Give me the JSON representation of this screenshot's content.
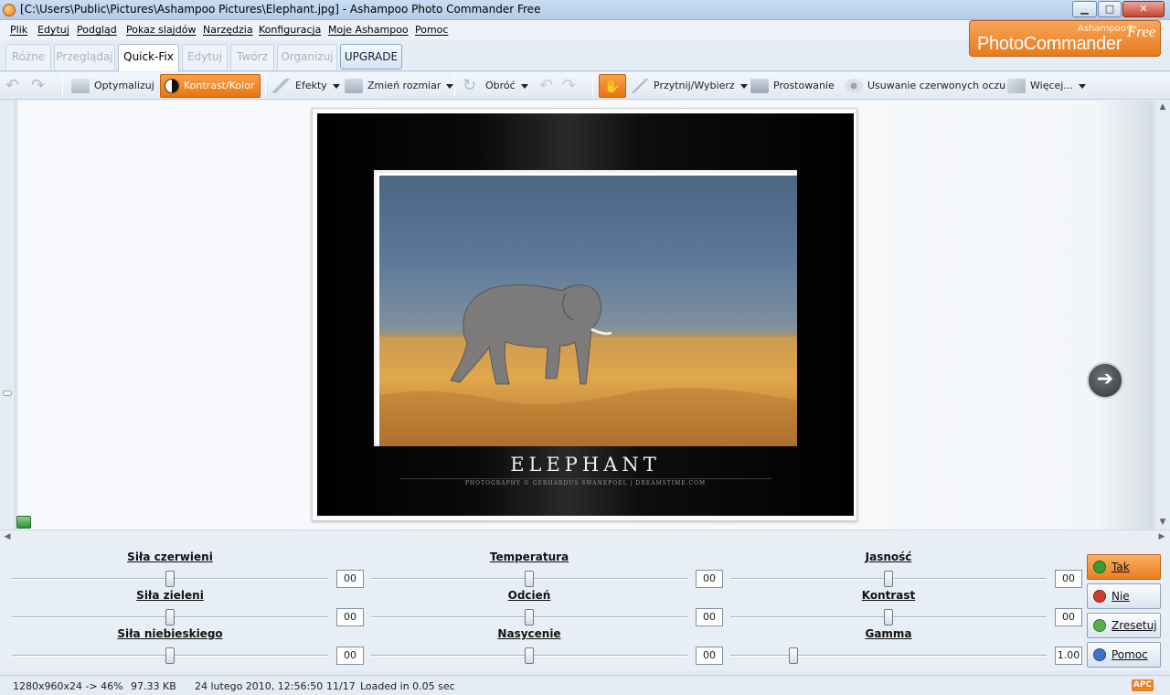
{
  "window": {
    "title": "[C:\\Users\\Public\\Pictures\\Ashampoo Pictures\\Elephant.jpg] - Ashampoo Photo Commander Free",
    "min_glyph": "▁",
    "max_glyph": "□",
    "close_glyph": "✕"
  },
  "menu": [
    "Plik",
    "Edytuj",
    "Podgląd",
    "Pokaz slajdów",
    "Narzędzia",
    "Konfiguracja",
    "Moje Ashampoo",
    "Pomoc"
  ],
  "brand": {
    "small": "Ashampoo®",
    "main": "PhotoCommander",
    "free": "Free"
  },
  "tabs": [
    "Różne",
    "Przeglądaj",
    "Quick-Fix",
    "Edytuj",
    "Twórz",
    "Organizuj",
    "UPGRADE"
  ],
  "toolbar": {
    "optymalizuj": "Optymalizuj",
    "kontrast": "Kontrast/Kolor",
    "efekty": "Efekty",
    "zmien": "Zmień rozmiar",
    "obroc": "Obróć",
    "przytnij": "Przytnij/Wybierz",
    "prostowanie": "Prostowanie",
    "usuwanie": "Usuwanie czerwonych oczu",
    "wiecej": "Więcej..."
  },
  "photo": {
    "title": "ELEPHANT",
    "credit": "PHOTOGRAPHY © GERHARDUS SWANEPOEL | DREAMSTIME.COM"
  },
  "sliders": [
    {
      "label": "Siła czerwieni",
      "value": "00",
      "level": 0.5
    },
    {
      "label": "Temperatura",
      "value": "00",
      "level": 0.5
    },
    {
      "label": "Jasność",
      "value": "00",
      "level": 0.5
    },
    {
      "label": "Siła zieleni",
      "value": "00",
      "level": 0.5
    },
    {
      "label": "Odcień",
      "value": "00",
      "level": 0.5
    },
    {
      "label": "Kontrast",
      "value": "00",
      "level": 0.5
    },
    {
      "label": "Siła niebieskiego",
      "value": "00",
      "level": 0.5
    },
    {
      "label": "Nasycenie",
      "value": "00",
      "level": 0.5
    },
    {
      "label": "Gamma",
      "value": "1.00",
      "level": 0.2
    }
  ],
  "actions": [
    "Tak",
    "Nie",
    "Zresetuj",
    "Pomoc"
  ],
  "status": {
    "dims": "1280x960x24 -> 46%",
    "size": "97.33 KB",
    "date": "24 lutego 2010, 12:56:50",
    "index": "11/17",
    "loaded": "Loaded in 0.05 sec",
    "badge": "APC"
  },
  "colors": {
    "accent": "#ea7d1f",
    "chrome": "#dfe8f3"
  }
}
